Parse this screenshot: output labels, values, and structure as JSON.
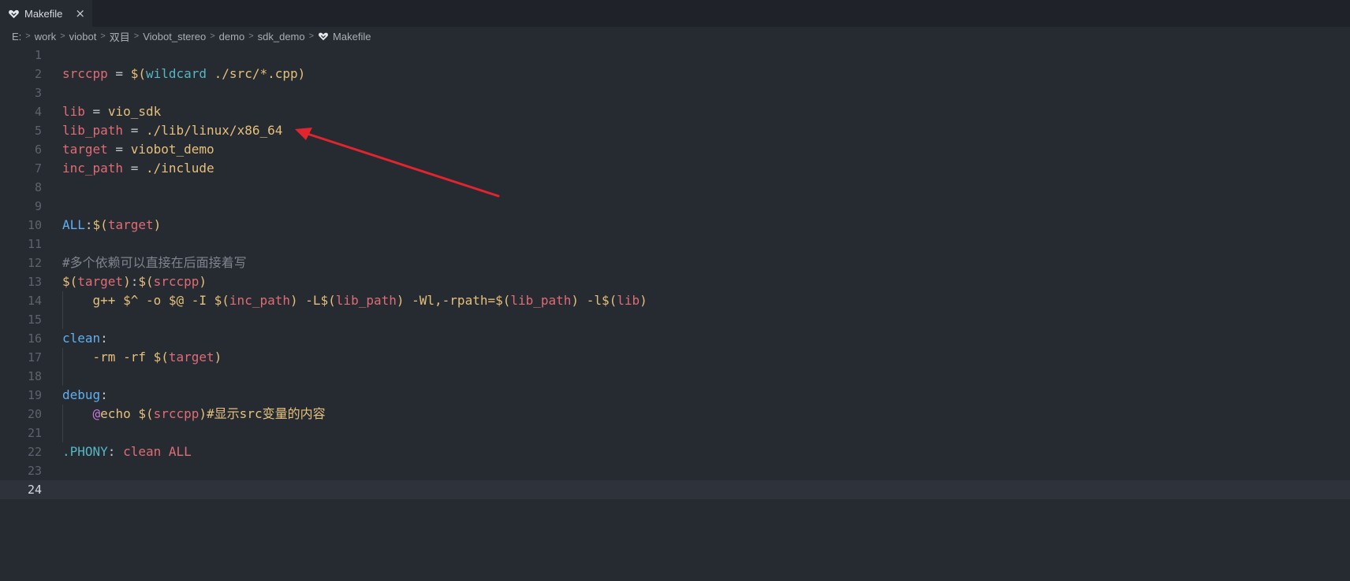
{
  "tab": {
    "title": "Makefile",
    "close": "×"
  },
  "breadcrumb": {
    "items": [
      "E:",
      "work",
      "viobot",
      "双目",
      "Viobot_stereo",
      "demo",
      "sdk_demo"
    ],
    "file": "Makefile",
    "separator": ">"
  },
  "editor": {
    "current_line": 24,
    "lines": [
      {
        "n": "1",
        "tokens": []
      },
      {
        "n": "2",
        "tokens": [
          {
            "t": "srccpp",
            "c": "v"
          },
          {
            "t": " = ",
            "c": "p"
          },
          {
            "t": "$(",
            "c": "s"
          },
          {
            "t": "wildcard",
            "c": "f"
          },
          {
            "t": " ./src/*.cpp",
            "c": "s"
          },
          {
            "t": ")",
            "c": "s"
          }
        ]
      },
      {
        "n": "3",
        "tokens": []
      },
      {
        "n": "4",
        "tokens": [
          {
            "t": "lib",
            "c": "v"
          },
          {
            "t": " = ",
            "c": "p"
          },
          {
            "t": "vio_sdk",
            "c": "s"
          }
        ]
      },
      {
        "n": "5",
        "tokens": [
          {
            "t": "lib_path",
            "c": "v"
          },
          {
            "t": " = ",
            "c": "p"
          },
          {
            "t": "./lib/linux/x86_64",
            "c": "s"
          }
        ]
      },
      {
        "n": "6",
        "tokens": [
          {
            "t": "target",
            "c": "v"
          },
          {
            "t": " = ",
            "c": "p"
          },
          {
            "t": "viobot_demo",
            "c": "s"
          }
        ]
      },
      {
        "n": "7",
        "tokens": [
          {
            "t": "inc_path",
            "c": "v"
          },
          {
            "t": " = ",
            "c": "p"
          },
          {
            "t": "./include",
            "c": "s"
          }
        ]
      },
      {
        "n": "8",
        "tokens": []
      },
      {
        "n": "9",
        "tokens": []
      },
      {
        "n": "10",
        "tokens": [
          {
            "t": "ALL",
            "c": "t"
          },
          {
            "t": ":",
            "c": "p"
          },
          {
            "t": "$(",
            "c": "s"
          },
          {
            "t": "target",
            "c": "v"
          },
          {
            "t": ")",
            "c": "s"
          }
        ]
      },
      {
        "n": "11",
        "tokens": []
      },
      {
        "n": "12",
        "tokens": [
          {
            "t": "#多个依赖可以直接在后面接着写",
            "c": "c"
          }
        ]
      },
      {
        "n": "13",
        "tokens": [
          {
            "t": "$(",
            "c": "s"
          },
          {
            "t": "target",
            "c": "v"
          },
          {
            "t": ")",
            "c": "s"
          },
          {
            "t": ":",
            "c": "p"
          },
          {
            "t": "$(",
            "c": "s"
          },
          {
            "t": "srccpp",
            "c": "v"
          },
          {
            "t": ")",
            "c": "s"
          }
        ]
      },
      {
        "n": "14",
        "guide": true,
        "tokens": [
          {
            "t": "    g++ $^ -o $@ -I ",
            "c": "s"
          },
          {
            "t": "$(",
            "c": "s"
          },
          {
            "t": "inc_path",
            "c": "v"
          },
          {
            "t": ")",
            "c": "s"
          },
          {
            "t": " -L",
            "c": "s"
          },
          {
            "t": "$(",
            "c": "s"
          },
          {
            "t": "lib_path",
            "c": "v"
          },
          {
            "t": ")",
            "c": "s"
          },
          {
            "t": " -Wl,-rpath=",
            "c": "s"
          },
          {
            "t": "$(",
            "c": "s"
          },
          {
            "t": "lib_path",
            "c": "v"
          },
          {
            "t": ")",
            "c": "s"
          },
          {
            "t": " -l",
            "c": "s"
          },
          {
            "t": "$(",
            "c": "s"
          },
          {
            "t": "lib",
            "c": "v"
          },
          {
            "t": ")",
            "c": "s"
          }
        ]
      },
      {
        "n": "15",
        "guide": true,
        "tokens": []
      },
      {
        "n": "16",
        "tokens": [
          {
            "t": "clean",
            "c": "t"
          },
          {
            "t": ":",
            "c": "p"
          }
        ]
      },
      {
        "n": "17",
        "guide": true,
        "tokens": [
          {
            "t": "    -rm -rf ",
            "c": "s"
          },
          {
            "t": "$(",
            "c": "s"
          },
          {
            "t": "target",
            "c": "v"
          },
          {
            "t": ")",
            "c": "s"
          }
        ]
      },
      {
        "n": "18",
        "guide": true,
        "tokens": []
      },
      {
        "n": "19",
        "tokens": [
          {
            "t": "debug",
            "c": "t"
          },
          {
            "t": ":",
            "c": "p"
          }
        ]
      },
      {
        "n": "20",
        "guide": true,
        "tokens": [
          {
            "t": "    ",
            "c": "p"
          },
          {
            "t": "@",
            "c": "k"
          },
          {
            "t": "echo ",
            "c": "s"
          },
          {
            "t": "$(",
            "c": "s"
          },
          {
            "t": "srccpp",
            "c": "v"
          },
          {
            "t": ")",
            "c": "s"
          },
          {
            "t": "#显示src变量的内容",
            "c": "s"
          }
        ]
      },
      {
        "n": "21",
        "guide": true,
        "tokens": []
      },
      {
        "n": "22",
        "tokens": [
          {
            "t": ".PHONY",
            "c": "f"
          },
          {
            "t": ": ",
            "c": "p"
          },
          {
            "t": "clean ALL",
            "c": "v"
          }
        ]
      },
      {
        "n": "23",
        "tokens": []
      },
      {
        "n": "24",
        "tokens": []
      }
    ]
  },
  "colors": {
    "background": "#262a31",
    "variable": "#e06c75",
    "string": "#e5c07b",
    "function": "#56b6c2",
    "target": "#61afef",
    "comment": "#7f848e",
    "annotation_arrow": "#e0252f"
  },
  "icons": {
    "file": "makefile-heart-icon",
    "close": "close-icon"
  }
}
